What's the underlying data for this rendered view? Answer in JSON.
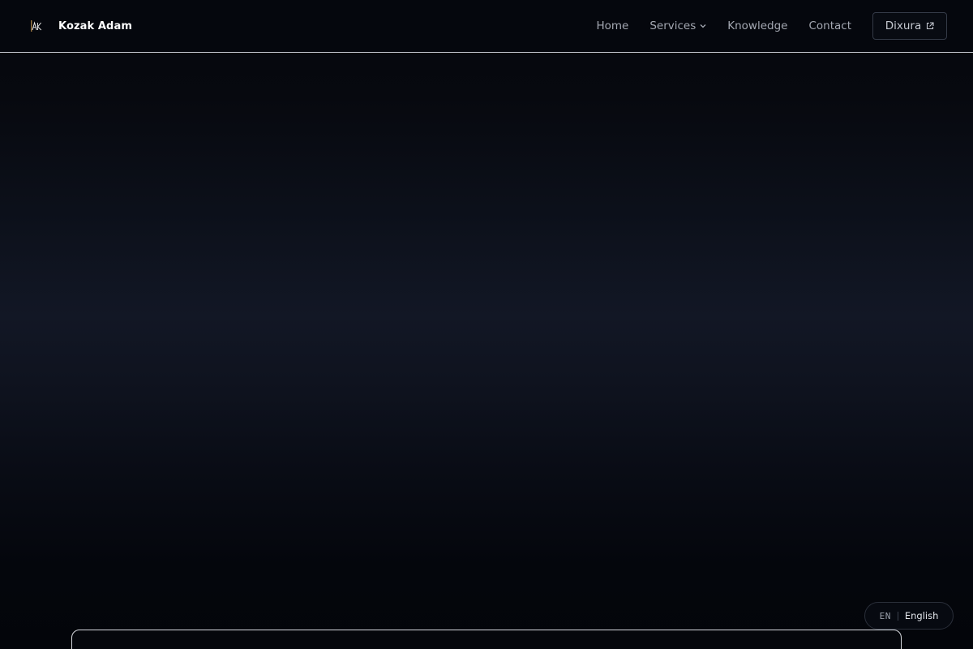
{
  "header": {
    "brand": {
      "logo_icon": "ak-monogram-icon",
      "name": "Kozak Adam"
    },
    "nav": [
      {
        "label": "Home"
      },
      {
        "label": "Services",
        "icon": "chevron-down-icon"
      },
      {
        "label": "Knowledge"
      },
      {
        "label": "Contact"
      }
    ],
    "external_button": {
      "label": "Dixura",
      "icon": "external-link-icon"
    }
  },
  "language_switcher": {
    "code": "EN",
    "name": "English"
  },
  "colors": {
    "background": "#05070d",
    "header_border": "#c9ccd4",
    "nav_text": "#a4a8b2",
    "brand_text": "#ffffff"
  }
}
